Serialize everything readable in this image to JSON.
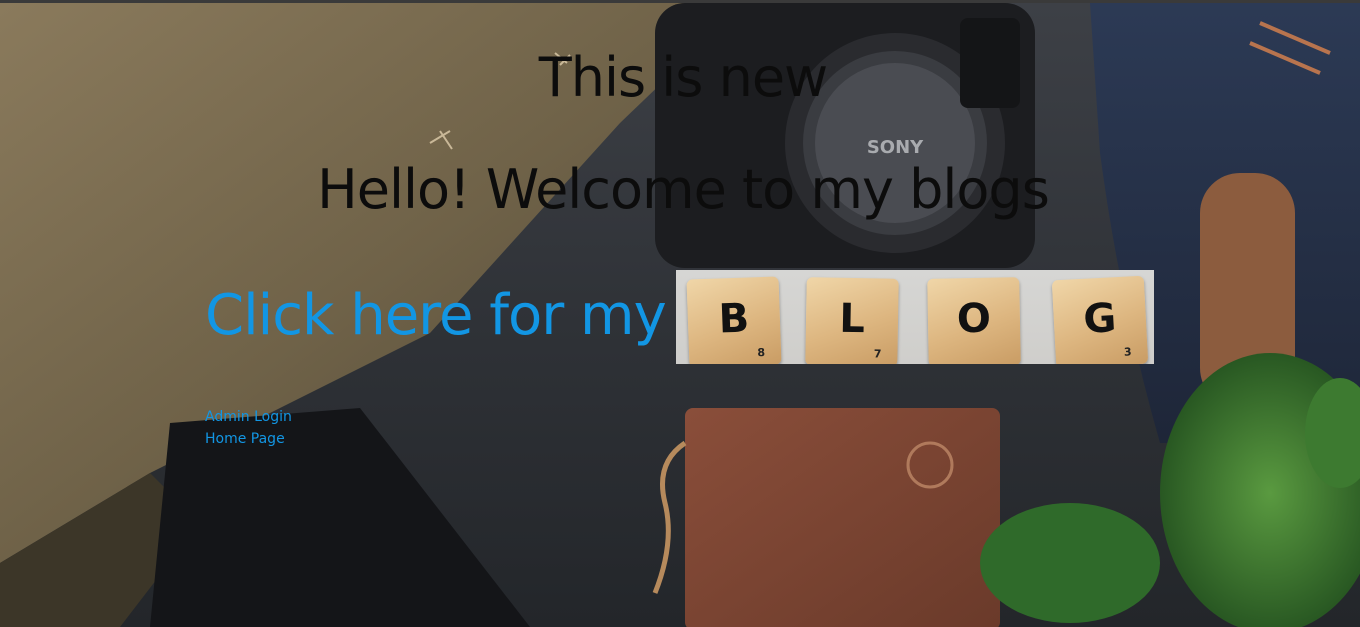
{
  "page": {
    "heading_1": "This is new",
    "heading_2": "Hello! Welcome to my blogs",
    "blog_link_text": "Click here for my",
    "blog_image": {
      "alt": "BLOG",
      "tiles": [
        {
          "letter": "B",
          "score": "8"
        },
        {
          "letter": "L",
          "score": "7"
        },
        {
          "letter": "O",
          "score": ""
        },
        {
          "letter": "G",
          "score": "3"
        }
      ]
    },
    "nav": {
      "admin_login": "Admin Login",
      "home_page": "Home Page"
    }
  },
  "colors": {
    "link": "#1296e4",
    "heading": "#0c0c0c"
  }
}
